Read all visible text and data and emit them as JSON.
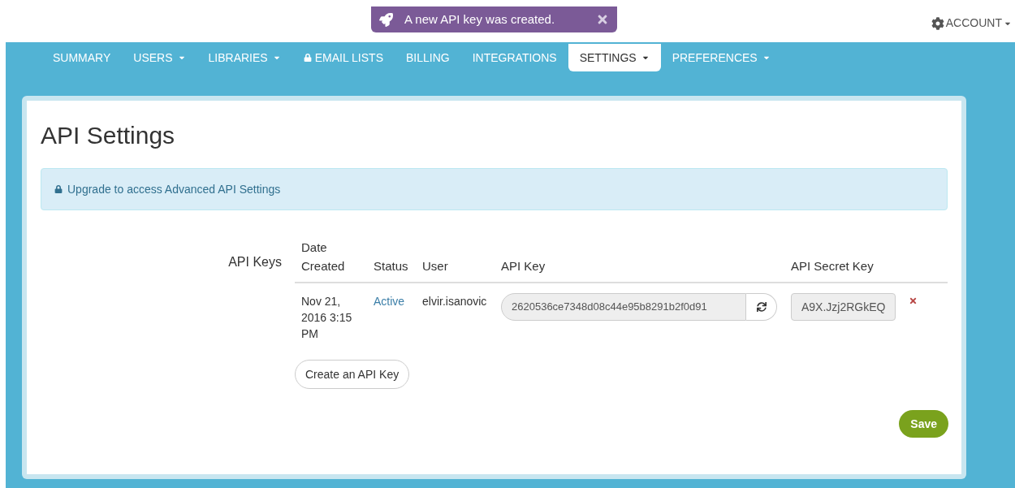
{
  "toast": {
    "message": "A new API key was created."
  },
  "account": {
    "label": "ACCOUNT"
  },
  "nav": [
    {
      "label": "SUMMARY",
      "dropdown": false,
      "locked": false,
      "selected": false
    },
    {
      "label": "USERS",
      "dropdown": true,
      "locked": false,
      "selected": false
    },
    {
      "label": "LIBRARIES",
      "dropdown": true,
      "locked": false,
      "selected": false
    },
    {
      "label": "EMAIL LISTS",
      "dropdown": false,
      "locked": true,
      "selected": false
    },
    {
      "label": "BILLING",
      "dropdown": false,
      "locked": false,
      "selected": false
    },
    {
      "label": "INTEGRATIONS",
      "dropdown": false,
      "locked": false,
      "selected": false
    },
    {
      "label": "SETTINGS",
      "dropdown": true,
      "locked": false,
      "selected": true
    },
    {
      "label": "PREFERENCES",
      "dropdown": true,
      "locked": false,
      "selected": false
    }
  ],
  "page": {
    "title": "API Settings",
    "notice": "Upgrade to access Advanced API Settings"
  },
  "api_keys": {
    "label": "API Keys",
    "columns": [
      "Date Created",
      "Status",
      "User",
      "API Key",
      "API Secret Key"
    ],
    "rows": [
      {
        "date": "Nov 21, 2016 3:15 PM",
        "status": "Active",
        "user": "elvir.isanovic",
        "api_key": "2620536ce7348d08c44e95b8291b2f0d91",
        "secret": "A9X.Jzj2RGkEQ"
      }
    ],
    "create_button": "Create an API Key"
  },
  "save_button": "Save"
}
